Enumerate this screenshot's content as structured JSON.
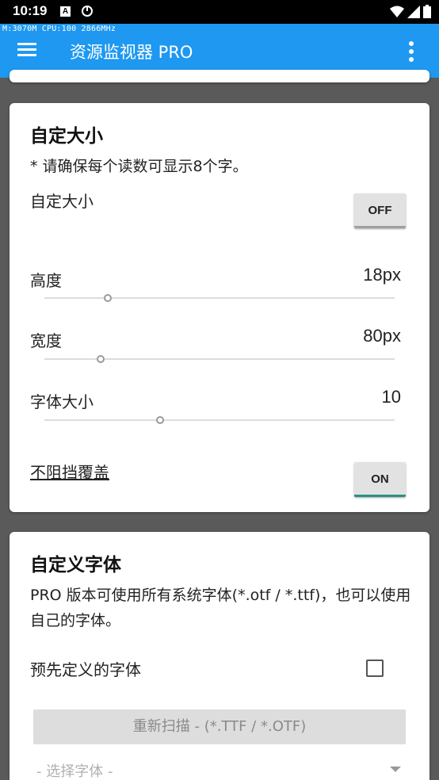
{
  "status_bar": {
    "time": "10:19",
    "notification_letter": "A"
  },
  "app_bar": {
    "monitor_text": "M:3070M CPU:100 2866MHz",
    "title": "资源监视器 PRO"
  },
  "custom_size_card": {
    "title": "自定大小",
    "note": "* 请确保每个读数可显示8个字。",
    "custom_size_label": "自定大小",
    "custom_size_toggle": "OFF",
    "height": {
      "label": "高度",
      "value": "18px",
      "slider_fraction": 0.18
    },
    "width": {
      "label": "宽度",
      "value": "80px",
      "slider_fraction": 0.16
    },
    "font_size": {
      "label": "字体大小",
      "value": "10",
      "slider_fraction": 0.33
    },
    "no_block_label": "不阻挡覆盖",
    "no_block_toggle": "ON"
  },
  "custom_font_card": {
    "title": "自定义字体",
    "description": "PRO 版本可使用所有系统字体(*.otf / *.ttf)，也可以使用自己的字体。",
    "predefined_label": "预先定义的字体",
    "predefined_checked": false,
    "rescan_label": "重新扫描 - (*.TTF / *.OTF)",
    "select_placeholder": "- 选择字体 -"
  },
  "colors": {
    "app_bar": "#1e98f0",
    "toggle_on_accent": "#2b8f88",
    "background": "#5a5a5a"
  }
}
